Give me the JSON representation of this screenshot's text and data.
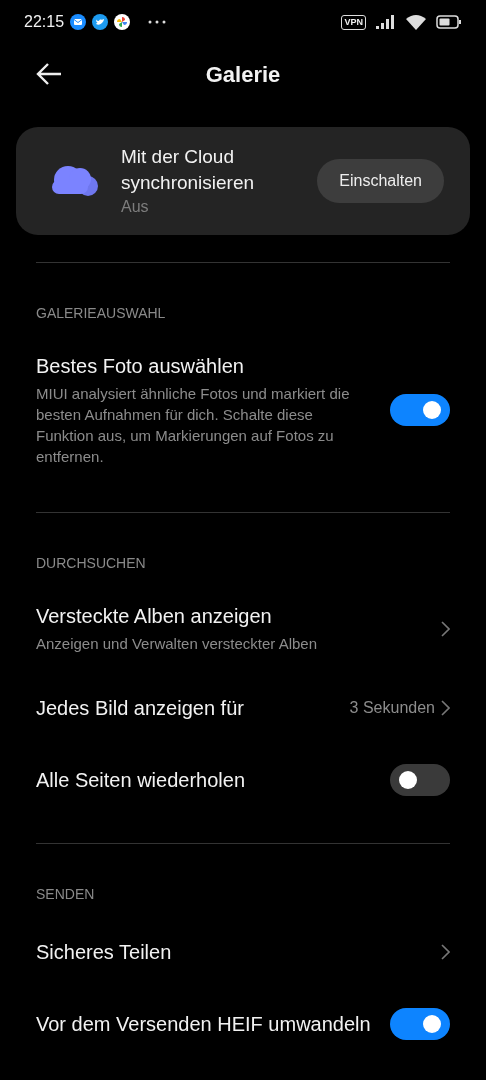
{
  "status_bar": {
    "time": "22:15",
    "vpn": "VPN"
  },
  "header": {
    "title": "Galerie"
  },
  "cloud_card": {
    "title": "Mit der Cloud synchronisieren",
    "status": "Aus",
    "button": "Einschalten"
  },
  "sections": [
    {
      "title": "GALERIEAUSWAHL",
      "items": [
        {
          "kind": "toggle",
          "title": "Bestes Foto auswählen",
          "description": "MIUI analysiert ähnliche Fotos und markiert die besten Aufnahmen für dich. Schalte diese Funktion aus, um Markierungen auf Fotos zu entfernen.",
          "on": true
        }
      ]
    },
    {
      "title": "DURCHSUCHEN",
      "items": [
        {
          "kind": "link",
          "title": "Versteckte Alben anzeigen",
          "description": "Anzeigen und Verwalten versteckter Alben"
        },
        {
          "kind": "value",
          "title": "Jedes Bild anzeigen für",
          "value": "3 Sekunden"
        },
        {
          "kind": "toggle",
          "title": "Alle Seiten wiederholen",
          "on": false
        }
      ]
    },
    {
      "title": "SENDEN",
      "items": [
        {
          "kind": "link",
          "title": "Sicheres Teilen"
        },
        {
          "kind": "toggle",
          "title": "Vor dem Versenden HEIF umwandeln",
          "on": true
        }
      ]
    }
  ]
}
